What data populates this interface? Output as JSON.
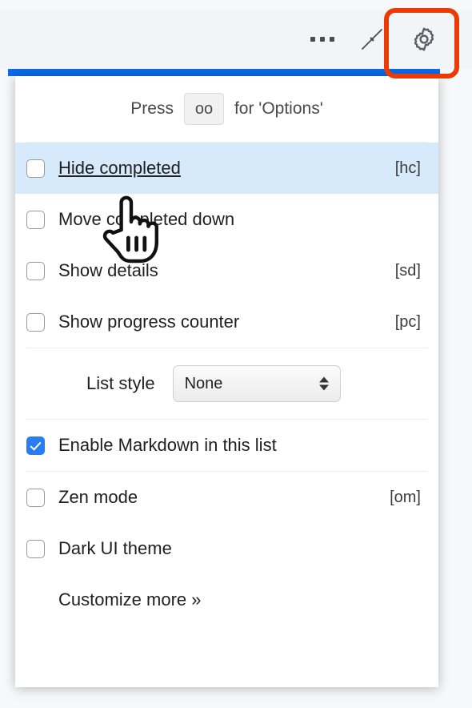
{
  "toolbar": {
    "more_label": "more-options",
    "collapse_label": "collapse",
    "settings_label": "settings",
    "highlight_color": "#ec3a07",
    "accent_color": "#0b6ae8"
  },
  "hint": {
    "prefix": "Press",
    "key": "oo",
    "suffix": "for 'Options'"
  },
  "menu": {
    "items": [
      {
        "label": "Hide completed",
        "shortcut": "[hc]",
        "checked": false,
        "hovered": true
      },
      {
        "label": "Move completed down",
        "shortcut": "",
        "checked": false,
        "hovered": false
      },
      {
        "label": "Show details",
        "shortcut": "[sd]",
        "checked": false,
        "hovered": false
      },
      {
        "label": "Show progress counter",
        "shortcut": "[pc]",
        "checked": false,
        "hovered": false
      },
      {
        "label": "Enable Markdown in this list",
        "shortcut": "",
        "checked": true,
        "hovered": false
      },
      {
        "label": "Zen mode",
        "shortcut": "[om]",
        "checked": false,
        "hovered": false
      },
      {
        "label": "Dark UI theme",
        "shortcut": "",
        "checked": false,
        "hovered": false
      }
    ],
    "list_style": {
      "label": "List style",
      "value": "None"
    },
    "customize_link": "Customize more »"
  },
  "colors": {
    "hover_row": "#d6eafb",
    "checkbox_checked": "#2a7cf0",
    "panel_bg": "#ffffff",
    "toolbar_bg": "#f2f5f8"
  }
}
